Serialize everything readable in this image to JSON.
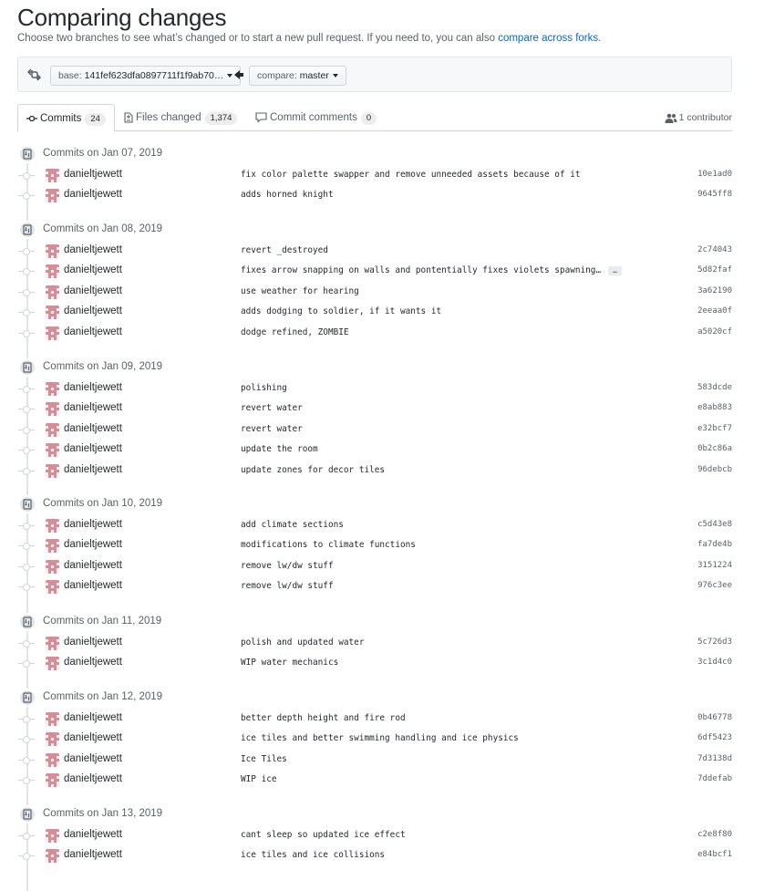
{
  "header": {
    "title": "Comparing changes",
    "subtitle_text": "Choose two branches to see what’s changed or to start a new pull request. If you need to, you can also ",
    "subtitle_link": "compare across forks",
    "subtitle_end": "."
  },
  "range": {
    "base_prefix": "base:",
    "base_value": "141fef623dfa0897711f1f9ab70…",
    "compare_prefix": "compare:",
    "compare_value": "master"
  },
  "tabs": [
    {
      "label": "Commits",
      "count": "24",
      "icon": "commit-icon"
    },
    {
      "label": "Files changed",
      "count": "1,374",
      "icon": "file-diff-icon"
    },
    {
      "label": "Commit comments",
      "count": "0",
      "icon": "comment-icon"
    }
  ],
  "contributors": "1 contributor",
  "groups": [
    {
      "label": "Commits on Jan 07, 2019",
      "commits": [
        {
          "author": "danieltjewett",
          "message": "fix color palette swapper and remove unneeded assets because of it",
          "sha": "10e1ad0"
        },
        {
          "author": "danieltjewett",
          "message": "adds horned knight",
          "sha": "9645ff8"
        }
      ]
    },
    {
      "label": "Commits on Jan 08, 2019",
      "commits": [
        {
          "author": "danieltjewett",
          "message": "revert _destroyed",
          "sha": "2c74043"
        },
        {
          "author": "danieltjewett",
          "message": "fixes arrow snapping on walls and pontentially fixes violets spawning…",
          "sha": "5d82faf",
          "ellipsis": "…"
        },
        {
          "author": "danieltjewett",
          "message": "use weather for hearing",
          "sha": "3a62190"
        },
        {
          "author": "danieltjewett",
          "message": "adds dodging to soldier, if it wants it",
          "sha": "2eeaa0f"
        },
        {
          "author": "danieltjewett",
          "message": "dodge refined, ZOMBIE",
          "sha": "a5020cf"
        }
      ]
    },
    {
      "label": "Commits on Jan 09, 2019",
      "commits": [
        {
          "author": "danieltjewett",
          "message": "polishing",
          "sha": "583dcde"
        },
        {
          "author": "danieltjewett",
          "message": "revert water",
          "sha": "e8ab883"
        },
        {
          "author": "danieltjewett",
          "message": "revert water",
          "sha": "e32bcf7"
        },
        {
          "author": "danieltjewett",
          "message": "update the room",
          "sha": "0b2c86a"
        },
        {
          "author": "danieltjewett",
          "message": "update zones for decor tiles",
          "sha": "96debcb"
        }
      ]
    },
    {
      "label": "Commits on Jan 10, 2019",
      "commits": [
        {
          "author": "danieltjewett",
          "message": "add climate sections",
          "sha": "c5d43e8"
        },
        {
          "author": "danieltjewett",
          "message": "modifications to climate functions",
          "sha": "fa7de4b"
        },
        {
          "author": "danieltjewett",
          "message": "remove lw/dw stuff",
          "sha": "3151224"
        },
        {
          "author": "danieltjewett",
          "message": "remove lw/dw stuff",
          "sha": "976c3ee"
        }
      ]
    },
    {
      "label": "Commits on Jan 11, 2019",
      "commits": [
        {
          "author": "danieltjewett",
          "message": "polish and updated water",
          "sha": "5c726d3"
        },
        {
          "author": "danieltjewett",
          "message": "WIP water mechanics",
          "sha": "3c1d4c0"
        }
      ]
    },
    {
      "label": "Commits on Jan 12, 2019",
      "commits": [
        {
          "author": "danieltjewett",
          "message": "better depth height and fire rod",
          "sha": "0b46778"
        },
        {
          "author": "danieltjewett",
          "message": "ice tiles and better swimming handling and ice physics",
          "sha": "6df5423"
        },
        {
          "author": "danieltjewett",
          "message": "Ice Tiles",
          "sha": "7d3138d"
        },
        {
          "author": "danieltjewett",
          "message": "WIP ice",
          "sha": "7ddefab"
        }
      ]
    },
    {
      "label": "Commits on Jan 13, 2019",
      "commits": [
        {
          "author": "danieltjewett",
          "message": "cant sleep so updated ice effect",
          "sha": "c2e8f80"
        },
        {
          "author": "danieltjewett",
          "message": "ice tiles and ice collisions",
          "sha": "e84bcf1"
        }
      ]
    }
  ]
}
